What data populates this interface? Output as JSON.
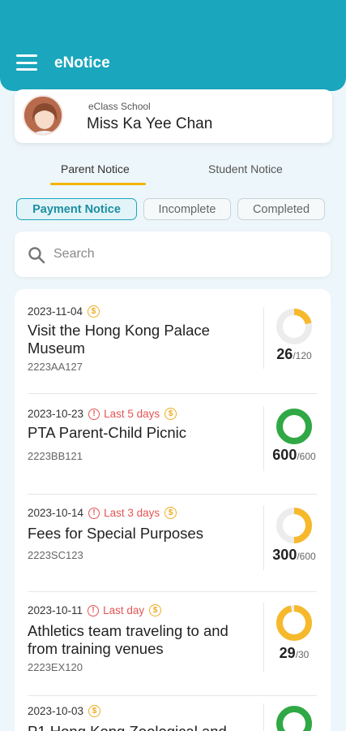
{
  "app": {
    "title": "eNotice"
  },
  "profile": {
    "school": "eClass School",
    "name": "Miss Ka Yee Chan"
  },
  "tabs": [
    {
      "label": "Parent Notice",
      "active": true
    },
    {
      "label": "Student Notice",
      "active": false
    }
  ],
  "filters": [
    {
      "label": "Payment Notice",
      "active": true
    },
    {
      "label": "Incomplete",
      "active": false
    },
    {
      "label": "Completed",
      "active": false
    }
  ],
  "search": {
    "placeholder": "Search",
    "value": ""
  },
  "colors": {
    "primary": "#1aa6bd",
    "tab_underline": "#f4b400",
    "progress_partial": "#f6b92b",
    "progress_complete": "#2fa845",
    "progress_track": "#ececec",
    "warning": "#e35454"
  },
  "notices": [
    {
      "date": "2023-11-04",
      "warning": "",
      "title": "Visit the Hong Kong Palace Museum",
      "code": "2223AA127",
      "done": 26,
      "total": 120,
      "done_label": "26",
      "total_label": "/120",
      "icon": "coin-icon"
    },
    {
      "date": "2023-10-23",
      "warning": "Last 5 days",
      "title": "PTA Parent-Child Picnic",
      "code": "2223BB121",
      "done": 600,
      "total": 600,
      "done_label": "600",
      "total_label": "/600",
      "icon": "coin-icon"
    },
    {
      "date": "2023-10-14",
      "warning": "Last 3 days",
      "title": "Fees for Special Purposes",
      "code": "2223SC123",
      "done": 300,
      "total": 600,
      "done_label": "300",
      "total_label": "/600",
      "icon": "coin-icon"
    },
    {
      "date": "2023-10-11",
      "warning": "Last day",
      "title": "Athletics team traveling to and from training venues",
      "code": "2223EX120",
      "done": 29,
      "total": 30,
      "done_label": "29",
      "total_label": "/30",
      "icon": "coin-icon"
    },
    {
      "date": "2023-10-03",
      "warning": "",
      "title": "P1 Hong Kong Zoological and",
      "code": "",
      "done": 1,
      "total": 1,
      "done_label": "",
      "total_label": "",
      "icon": "coin-icon"
    }
  ]
}
